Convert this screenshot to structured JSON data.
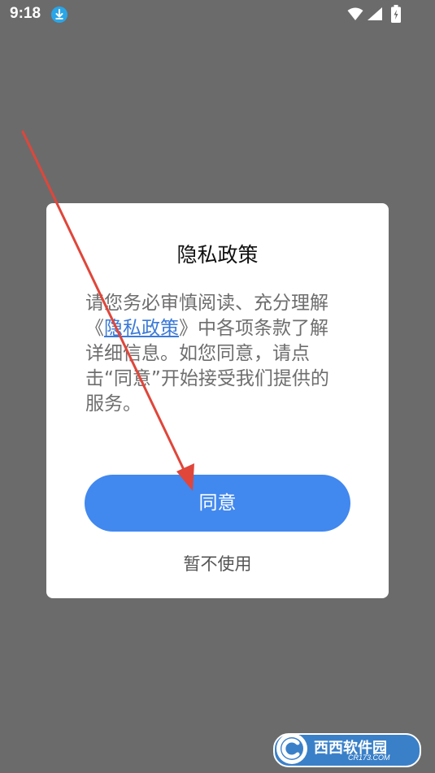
{
  "status_bar": {
    "time": "9:18",
    "icons": [
      "download-icon",
      "wifi-icon",
      "signal-icon",
      "battery-icon"
    ]
  },
  "dialog": {
    "title": "隐私政策",
    "body_prefix": "请您务必审慎阅读、充分理解《",
    "policy_link": "隐私政策",
    "body_suffix": "》中各项条款了解详细信息。如您同意，请点击“同意”开始接受我们提供的服务。",
    "agree_button": "同意",
    "decline_link": "暂不使用"
  },
  "watermark": {
    "text": "西西软件园",
    "sub": "CR173.COM"
  },
  "colors": {
    "overlay": "#6b6b6b",
    "primary": "#4188ef",
    "link": "#3b7ad8",
    "annotation_arrow": "#e0463a"
  }
}
